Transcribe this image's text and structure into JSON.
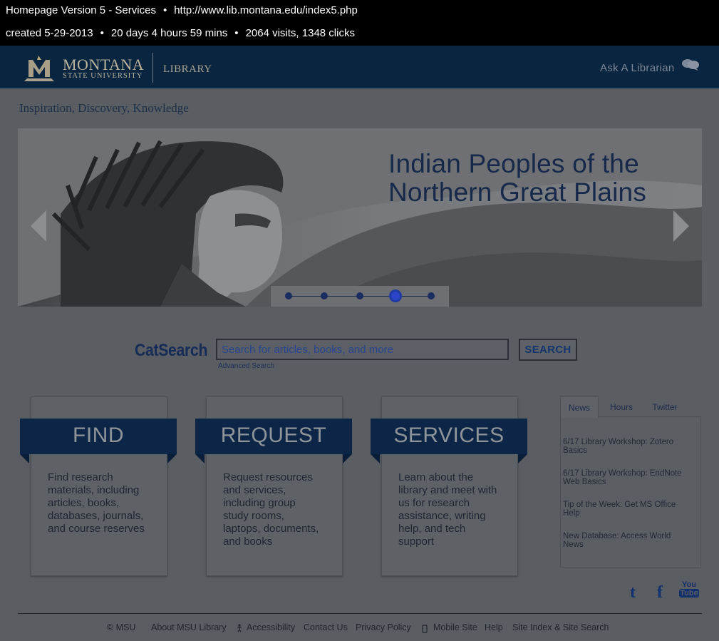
{
  "info": {
    "title": "Homepage Version 5 - Services",
    "url": "http://www.lib.montana.edu/index5.php",
    "created": "created 5-29-2013",
    "duration": "20 days 4 hours 59 mins",
    "stats": "2064 visits, 1348 clicks",
    "separator": "•"
  },
  "header": {
    "logo_line1": "MONTANA",
    "logo_line2": "STATE UNIVERSITY",
    "library": "LIBRARY",
    "ask": "Ask A Librarian",
    "ask_icon": "speech-bubbles-icon",
    "logo_icon": "msu-m-logo-icon"
  },
  "tagline": "Inspiration, Discovery, Knowledge",
  "hero": {
    "title_line1": "Indian Peoples of the",
    "title_line2": "Northern Great Plains",
    "slide_count": 5,
    "active_slide": 4
  },
  "search": {
    "label": "CatSearch",
    "placeholder": "Search for articles, books, and more",
    "button": "SEARCH",
    "advanced": "Advanced Search"
  },
  "cards": [
    {
      "title": "FIND",
      "lines": [
        "Find research",
        "materials, including",
        "articles, books,",
        "databases, journals,",
        "and course reserves"
      ]
    },
    {
      "title": "REQUEST",
      "lines": [
        "Request resources",
        "and services,",
        "including group",
        "study rooms,",
        "laptops, documents,",
        "and books"
      ]
    },
    {
      "title": "SERVICES",
      "lines": [
        "Learn about the",
        "library and meet with",
        "us for research",
        "assistance, writing",
        "help, and tech",
        "support"
      ]
    }
  ],
  "tabs": [
    "News",
    "Hours",
    "Twitter"
  ],
  "news": [
    {
      "l1": "6/17 Library Workshop: Zotero",
      "l2": "Basics"
    },
    {
      "l1": "6/17 Library Workshop: EndNote",
      "l2": "Web Basics"
    },
    {
      "l1": "Tip of the Week: Get MS Office",
      "l2": "Help"
    },
    {
      "l1": "New Database: Access World",
      "l2": "News"
    }
  ],
  "social": {
    "twitter_icon": "twitter-icon",
    "facebook_icon": "facebook-icon",
    "youtube_icon": "youtube-icon",
    "twitter": "t",
    "facebook": "f",
    "youtube_top": "You",
    "youtube_bottom": "Tube"
  },
  "footer": {
    "copyright": "© MSU",
    "about": "About MSU Library",
    "accessibility": "Accessibility",
    "contact": "Contact Us",
    "privacy": "Privacy Policy",
    "mobile": "Mobile Site",
    "help": "Help",
    "siteindex": "Site Index & Site Search"
  }
}
